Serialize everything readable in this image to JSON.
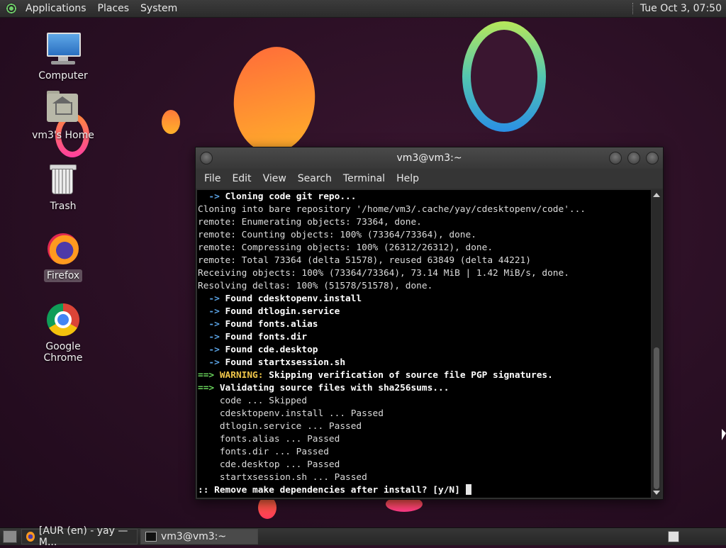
{
  "top_panel": {
    "menus": [
      "Applications",
      "Places",
      "System"
    ],
    "clock": "Tue Oct  3, 07:50"
  },
  "desktop_icons": [
    {
      "label": "Computer",
      "icon": "computer-icon"
    },
    {
      "label": "vm3's Home",
      "icon": "home-folder-icon"
    },
    {
      "label": "Trash",
      "icon": "trash-icon"
    },
    {
      "label": "Firefox",
      "icon": "firefox-icon",
      "selected": true
    },
    {
      "label": "Google Chrome",
      "icon": "chrome-icon"
    }
  ],
  "terminal": {
    "title": "vm3@vm3:~",
    "menu": [
      "File",
      "Edit",
      "View",
      "Search",
      "Terminal",
      "Help"
    ],
    "lines": [
      {
        "prefix": "  -> ",
        "text": "Cloning code git repo...",
        "style": "arrow-bold"
      },
      {
        "prefix": "",
        "text": "Cloning into bare repository '/home/vm3/.cache/yay/cdesktopenv/code'...",
        "style": "plain"
      },
      {
        "prefix": "",
        "text": "remote: Enumerating objects: 73364, done.",
        "style": "plain"
      },
      {
        "prefix": "",
        "text": "remote: Counting objects: 100% (73364/73364), done.",
        "style": "plain"
      },
      {
        "prefix": "",
        "text": "remote: Compressing objects: 100% (26312/26312), done.",
        "style": "plain"
      },
      {
        "prefix": "",
        "text": "remote: Total 73364 (delta 51578), reused 63849 (delta 44221)",
        "style": "plain"
      },
      {
        "prefix": "",
        "text": "Receiving objects: 100% (73364/73364), 73.14 MiB | 1.42 MiB/s, done.",
        "style": "plain"
      },
      {
        "prefix": "",
        "text": "Resolving deltas: 100% (51578/51578), done.",
        "style": "plain"
      },
      {
        "prefix": "  -> ",
        "text": "Found cdesktopenv.install",
        "style": "arrow-bold"
      },
      {
        "prefix": "  -> ",
        "text": "Found dtlogin.service",
        "style": "arrow-bold"
      },
      {
        "prefix": "  -> ",
        "text": "Found fonts.alias",
        "style": "arrow-bold"
      },
      {
        "prefix": "  -> ",
        "text": "Found fonts.dir",
        "style": "arrow-bold"
      },
      {
        "prefix": "  -> ",
        "text": "Found cde.desktop",
        "style": "arrow-bold"
      },
      {
        "prefix": "  -> ",
        "text": "Found startxsession.sh",
        "style": "arrow-bold"
      },
      {
        "prefix": "==> ",
        "label": "WARNING:",
        "text": " Skipping verification of source file PGP signatures.",
        "style": "warning"
      },
      {
        "prefix": "==> ",
        "text": "Validating source files with sha256sums...",
        "style": "green-bold"
      },
      {
        "prefix": "",
        "text": "    code ... Skipped",
        "style": "plain"
      },
      {
        "prefix": "",
        "text": "    cdesktopenv.install ... Passed",
        "style": "plain"
      },
      {
        "prefix": "",
        "text": "    dtlogin.service ... Passed",
        "style": "plain"
      },
      {
        "prefix": "",
        "text": "    fonts.alias ... Passed",
        "style": "plain"
      },
      {
        "prefix": "",
        "text": "    fonts.dir ... Passed",
        "style": "plain"
      },
      {
        "prefix": "",
        "text": "    cde.desktop ... Passed",
        "style": "plain"
      },
      {
        "prefix": "",
        "text": "    startxsession.sh ... Passed",
        "style": "plain"
      },
      {
        "prefix": "",
        "text": ":: Remove make dependencies after install? [y/N] ",
        "style": "bold-prompt"
      }
    ]
  },
  "taskbar": {
    "tasks": [
      {
        "label": "[AUR (en) - yay — M...",
        "icon": "firefox-icon",
        "active": false
      },
      {
        "label": "vm3@vm3:~",
        "icon": "terminal-icon",
        "active": true
      }
    ]
  },
  "colors": {
    "arrow": "#5ba4e6",
    "green": "#6ad65c",
    "warning": "#f0c64a",
    "terminal_bg": "#000000"
  }
}
